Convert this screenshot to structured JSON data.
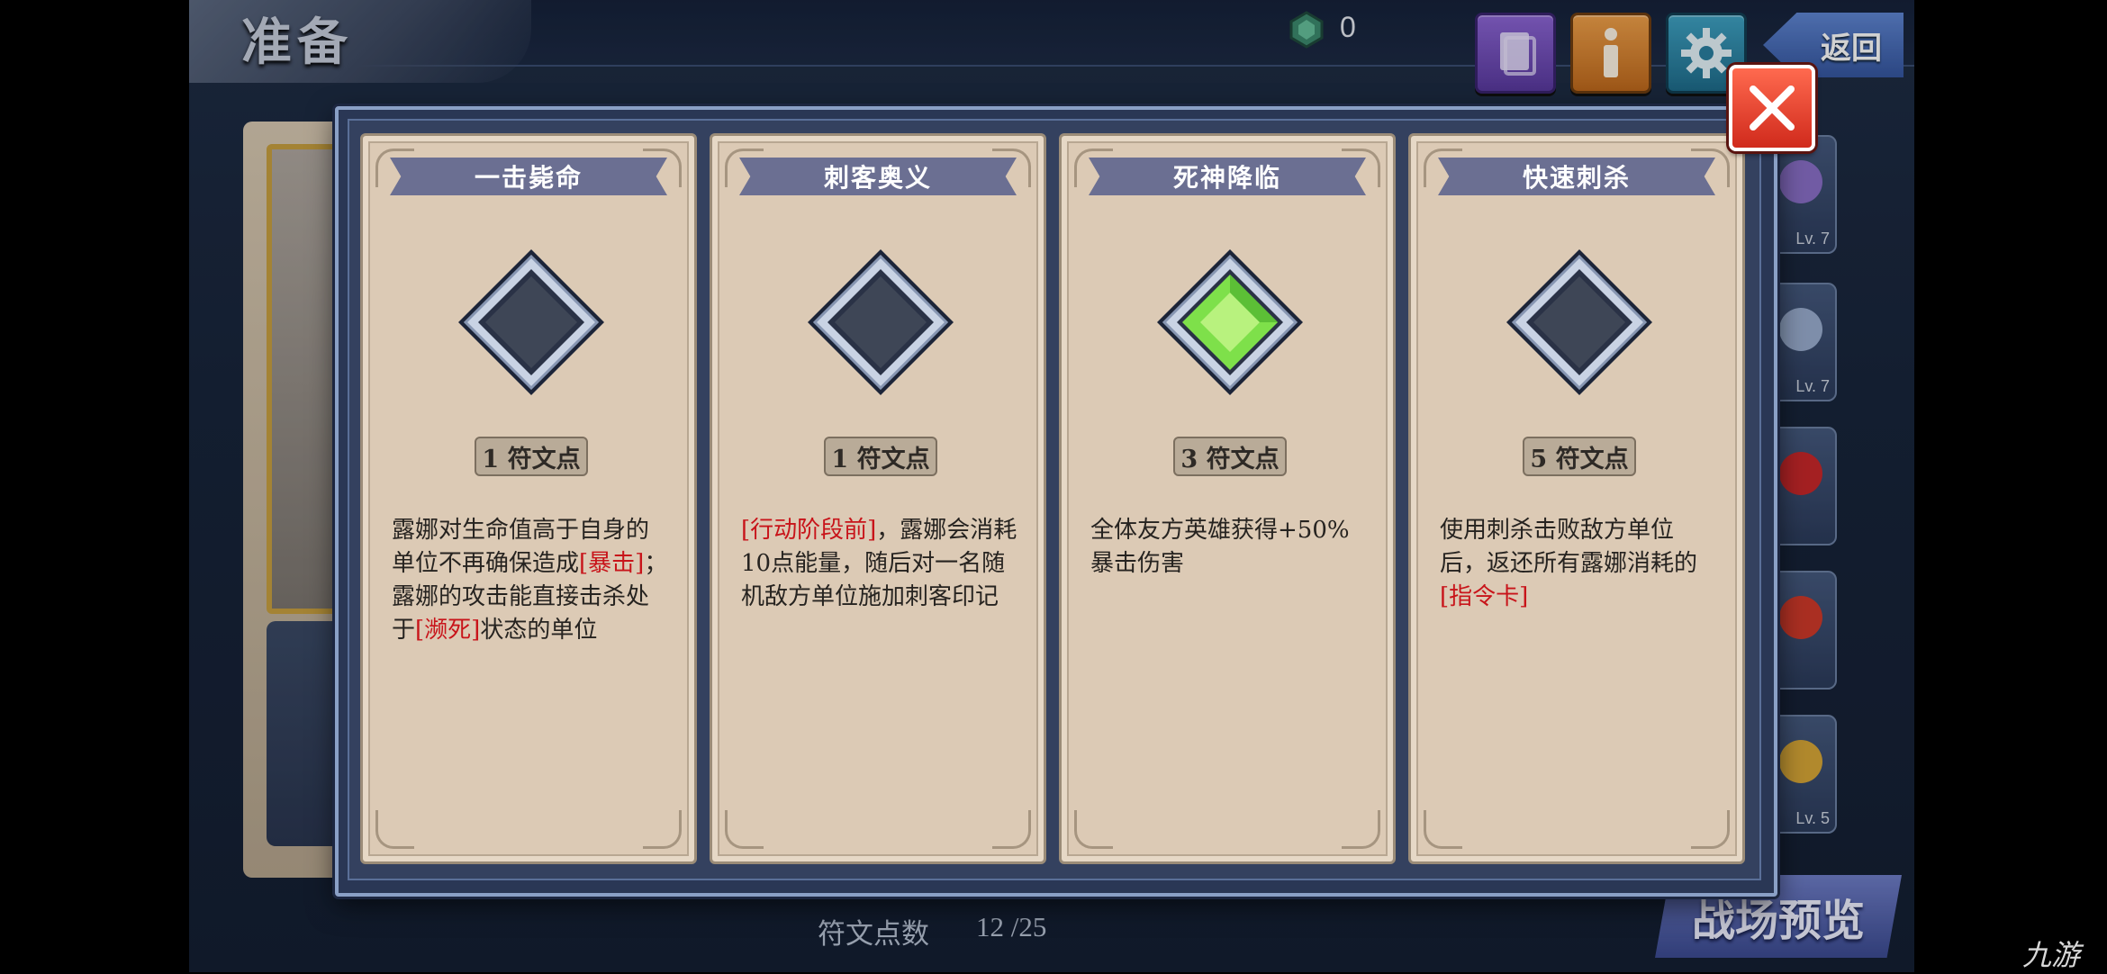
{
  "header": {
    "title": "准备",
    "gem_count": "0",
    "back_label": "返回"
  },
  "heroes": [
    {
      "level": "Lv. 7"
    },
    {
      "level": "Lv. 7"
    },
    {
      "level": ""
    },
    {
      "level": ""
    },
    {
      "level": "Lv. 5"
    }
  ],
  "rune_cards": [
    {
      "title": "一击毙命",
      "cost": "1 符文点",
      "active": false,
      "desc": [
        {
          "t": "露娜对生命值高于自身的单位不再确保造成",
          "hl": false
        },
        {
          "t": "[暴击]",
          "hl": true
        },
        {
          "t": "；露娜的攻击能直接击杀处于",
          "hl": false
        },
        {
          "t": "[濒死]",
          "hl": true
        },
        {
          "t": "状态的单位",
          "hl": false
        }
      ]
    },
    {
      "title": "刺客奥义",
      "cost": "1 符文点",
      "active": false,
      "desc": [
        {
          "t": "[行动阶段前]",
          "hl": true
        },
        {
          "t": "，露娜会消耗10点能量，随后对一名随机敌方单位施加刺客印记",
          "hl": false
        }
      ]
    },
    {
      "title": "死神降临",
      "cost": "3 符文点",
      "active": true,
      "desc": [
        {
          "t": "全体友方英雄获得+50%暴击伤害",
          "hl": false
        }
      ]
    },
    {
      "title": "快速刺杀",
      "cost": "5 符文点",
      "active": false,
      "desc": [
        {
          "t": "使用刺杀击败敌方单位后，返还所有露娜消耗的",
          "hl": false
        },
        {
          "t": "[指令卡]",
          "hl": true
        }
      ]
    }
  ],
  "footer": {
    "rune_points_label": "符文点数",
    "rune_points_value": "12 /25",
    "preview_label": "战场预览",
    "watermark": "九游"
  },
  "colors": {
    "highlight": "#c8141a",
    "active_gem": "#7ee04a",
    "empty_gem": "#3e4656",
    "close_button": "#e0402c"
  }
}
